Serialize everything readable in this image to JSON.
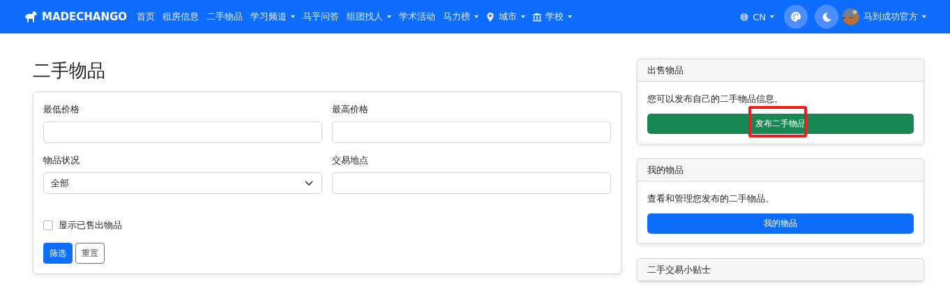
{
  "navbar": {
    "brand": "MADECHANGO",
    "items": [
      {
        "label": "首页",
        "dropdown": false
      },
      {
        "label": "租房信息",
        "dropdown": false
      },
      {
        "label": "二手物品",
        "dropdown": false
      },
      {
        "label": "学习频道",
        "dropdown": true
      },
      {
        "label": "马乎问答",
        "dropdown": false
      },
      {
        "label": "组团找人",
        "dropdown": true
      },
      {
        "label": "学术活动",
        "dropdown": false
      },
      {
        "label": "马力榜",
        "dropdown": true
      },
      {
        "label": "城市",
        "dropdown": true
      },
      {
        "label": "学校",
        "dropdown": true
      }
    ],
    "language": "CN",
    "user": "马到成功官方"
  },
  "page_title": "二手物品",
  "filter": {
    "min_price": {
      "label": "最低价格"
    },
    "max_price": {
      "label": "最高价格"
    },
    "condition": {
      "label": "物品状况",
      "value": "全部"
    },
    "location": {
      "label": "交易地点"
    },
    "show_sold": {
      "label": "显示已售出物品",
      "checked": false
    },
    "buttons": [
      {
        "label": "筛选",
        "kind": "primary"
      },
      {
        "label": "重置",
        "kind": "outline"
      }
    ]
  },
  "sidebar": [
    {
      "title": "出售物品",
      "text": "您可以发布自己的二手物品信息。",
      "button": {
        "label": "发布二手物品",
        "kind": "success",
        "highlighted": true
      }
    },
    {
      "title": "我的物品",
      "text": "查看和管理您发布的二手物品。",
      "button": {
        "label": "我的物品",
        "kind": "primary",
        "highlighted": false
      }
    },
    {
      "title": "二手交易小贴士"
    }
  ]
}
